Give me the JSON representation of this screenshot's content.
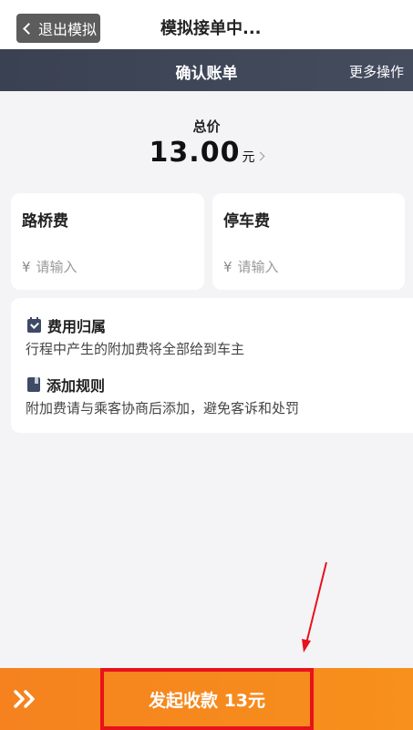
{
  "top": {
    "exit_label": "退出模拟",
    "title": "模拟接单中..."
  },
  "nav": {
    "title": "确认账单",
    "more_label": "更多操作"
  },
  "total": {
    "label": "总价",
    "amount": "13.00",
    "unit": "元"
  },
  "fees": [
    {
      "title": "路桥费",
      "currency": "¥",
      "placeholder": "请输入"
    },
    {
      "title": "停车费",
      "currency": "¥",
      "placeholder": "请输入"
    }
  ],
  "info": {
    "ownership": {
      "heading": "费用归属",
      "icon": "calendar-check-icon",
      "text": "行程中产生的附加费将全部给到车主"
    },
    "rule": {
      "heading": "添加规则",
      "icon": "book-icon",
      "text": "附加费请与乘客协商后添加，避免客诉和处罚"
    }
  },
  "bottom": {
    "chevron_icon": "double-chevron-right-icon",
    "collect_label": "发起收款 13元"
  },
  "colors": {
    "nav_bg": "#3a4152",
    "bottom_bg": "#f5821f",
    "annotation_red": "#e8121b",
    "icon_navy": "#3e4a66"
  }
}
